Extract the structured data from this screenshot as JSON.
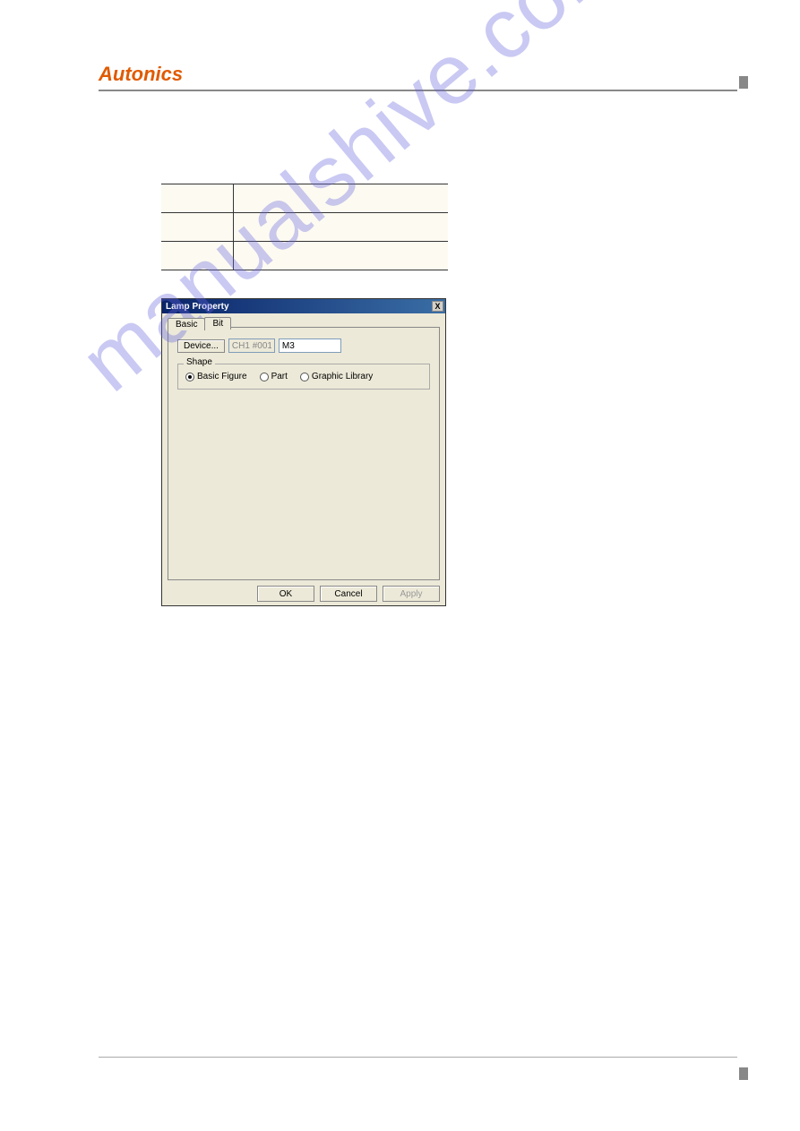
{
  "header": {
    "brand": "Autonics"
  },
  "dialog": {
    "title": "Lamp Property",
    "close": "X",
    "tabs": {
      "basic": "Basic",
      "bit": "Bit"
    },
    "device_button": "Device...",
    "device_channel": "CH1 #001",
    "device_value": "M3",
    "shape_label": "Shape",
    "radios": {
      "basic_figure": "Basic Figure",
      "part": "Part",
      "graphic_library": "Graphic Library"
    },
    "buttons": {
      "ok": "OK",
      "cancel": "Cancel",
      "apply": "Apply"
    }
  },
  "watermark": "manualshive.com"
}
